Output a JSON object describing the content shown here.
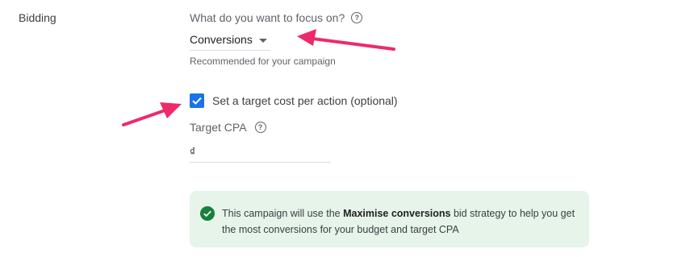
{
  "section": {
    "label": "Bidding"
  },
  "focus": {
    "question": "What do you want to focus on?",
    "selected": "Conversions",
    "hint": "Recommended for your campaign"
  },
  "target_cpa": {
    "checkbox_label": "Set a target cost per action (optional)",
    "checked": true,
    "label": "Target CPA",
    "currency": "₫"
  },
  "info": {
    "text_before": "This campaign will use the ",
    "strategy": "Maximise conversions",
    "text_after": " bid strategy to help you get the most conversions for your budget and target CPA"
  },
  "icons": {
    "help": "help-circle-icon",
    "dropdown": "caret-down-icon",
    "check": "checkmark-icon",
    "success": "check-circle-icon"
  },
  "colors": {
    "accent": "#1a73e8",
    "success": "#188038",
    "info_bg": "#e6f4ea",
    "annotation_arrow": "#ee2a6a"
  }
}
